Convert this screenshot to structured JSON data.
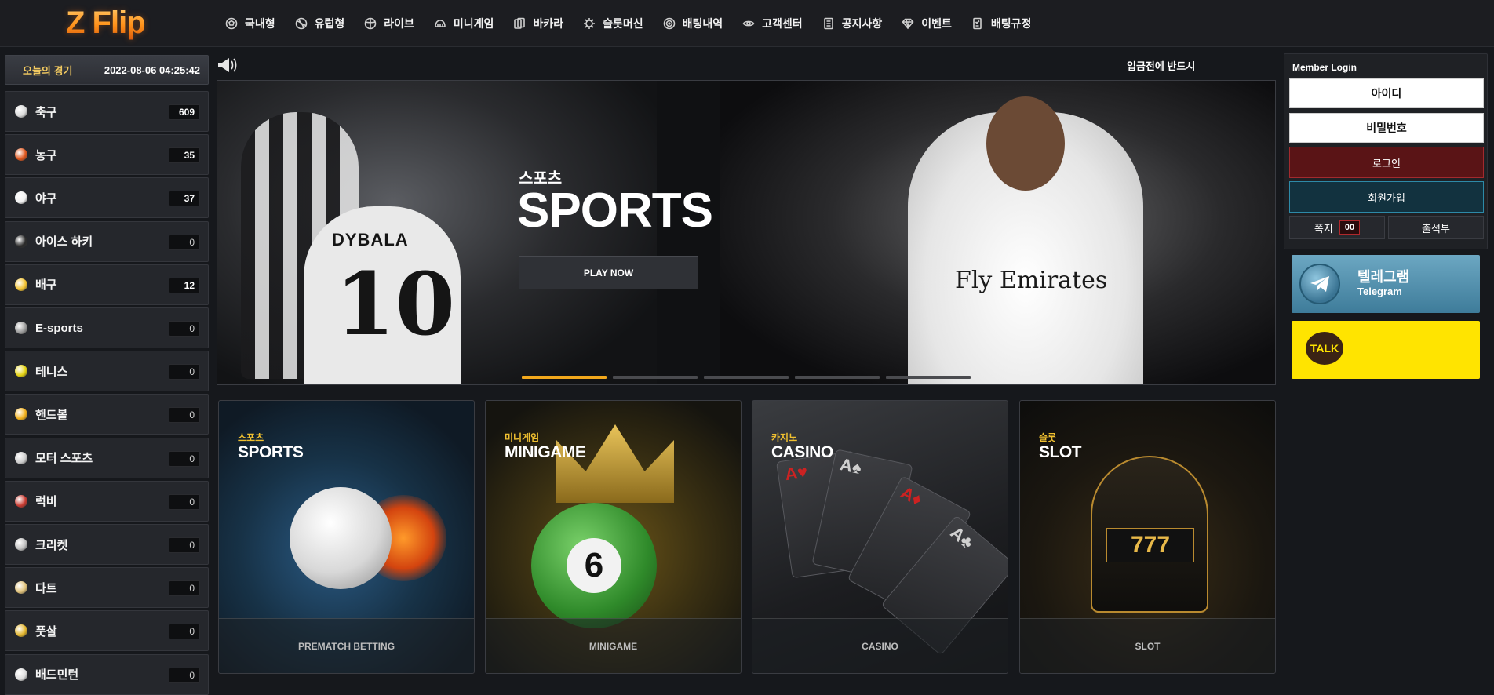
{
  "brand": {
    "logo_text": "Z Flip"
  },
  "nav": [
    {
      "label": "국내형",
      "icon": "soccer-ball-icon"
    },
    {
      "label": "유럽형",
      "icon": "sports-ball-icon"
    },
    {
      "label": "라이브",
      "icon": "live-icon"
    },
    {
      "label": "미니게임",
      "icon": "minigame-icon"
    },
    {
      "label": "바카라",
      "icon": "cards-icon"
    },
    {
      "label": "슬롯머신",
      "icon": "slot-icon"
    },
    {
      "label": "배팅내역",
      "icon": "target-icon"
    },
    {
      "label": "고객센터",
      "icon": "support-icon"
    },
    {
      "label": "공지사항",
      "icon": "notice-icon"
    },
    {
      "label": "이벤트",
      "icon": "diamond-icon"
    },
    {
      "label": "배팅규정",
      "icon": "rules-icon"
    }
  ],
  "sidebar": {
    "title": "오늘의 경기",
    "datetime": "2022-08-06 04:25:42",
    "sports": [
      {
        "name": "축구",
        "count": "609",
        "icon": "soccer-icon",
        "color": "#d9d9d9"
      },
      {
        "name": "농구",
        "count": "35",
        "icon": "basketball-icon",
        "color": "#e0561c"
      },
      {
        "name": "야구",
        "count": "37",
        "icon": "baseball-icon",
        "color": "#f1f1f1"
      },
      {
        "name": "아이스 하키",
        "count": "0",
        "icon": "hockey-puck-icon",
        "color": "#2a2a2a"
      },
      {
        "name": "배구",
        "count": "12",
        "icon": "volleyball-icon",
        "color": "#f3c230"
      },
      {
        "name": "E-sports",
        "count": "0",
        "icon": "gamepad-icon",
        "color": "#9a9a9a"
      },
      {
        "name": "테니스",
        "count": "0",
        "icon": "tennis-ball-icon",
        "color": "#e4d20f"
      },
      {
        "name": "핸드볼",
        "count": "0",
        "icon": "handball-icon",
        "color": "#f2b01a"
      },
      {
        "name": "모터 스포츠",
        "count": "0",
        "icon": "checkered-flag-icon",
        "color": "#cccccc"
      },
      {
        "name": "럭비",
        "count": "0",
        "icon": "rugby-ball-icon",
        "color": "#c8392f"
      },
      {
        "name": "크리켓",
        "count": "0",
        "icon": "cricket-icon",
        "color": "#bfbfbf"
      },
      {
        "name": "다트",
        "count": "0",
        "icon": "dart-icon",
        "color": "#e0c27a"
      },
      {
        "name": "풋살",
        "count": "0",
        "icon": "futsal-icon",
        "color": "#e2b42a"
      },
      {
        "name": "배드민턴",
        "count": "0",
        "icon": "badminton-icon",
        "color": "#dddddd"
      }
    ]
  },
  "notice": {
    "text": "입금전에 반드시"
  },
  "banner": {
    "ko_title": "스포츠",
    "en_title": "SPORTS",
    "button": "PLAY NOW",
    "jersey_name": "DYBALA",
    "jersey_number": "10",
    "sponsor": "Fly Emirates",
    "slides": 5,
    "active_slide": 0
  },
  "cards": [
    {
      "ko": "스포츠",
      "en": "SPORTS",
      "footer": "PREMATCH BETTING"
    },
    {
      "ko": "미니게임",
      "en": "MINIGAME",
      "footer": "MINIGAME"
    },
    {
      "ko": "카지노",
      "en": "CASINO",
      "footer": "CASINO"
    },
    {
      "ko": "슬롯",
      "en": "SLOT",
      "footer": "SLOT"
    }
  ],
  "minigame_ball_number": "6",
  "slot_reels": "777",
  "login": {
    "title": "Member Login",
    "id_placeholder": "아이디",
    "pw_placeholder": "비밀번호",
    "login_button": "로그인",
    "signup_button": "회원가입",
    "message_label": "쪽지",
    "message_count": "00",
    "attendance": "출석부"
  },
  "telegram": {
    "title": "텔레그램",
    "subtitle": "Telegram"
  },
  "kakao": {
    "label": "TALK"
  },
  "colors": {
    "accent": "#f2a81c",
    "login_red": "#5a1416",
    "signup_blue": "#12323f",
    "kakao": "#ffe400"
  }
}
